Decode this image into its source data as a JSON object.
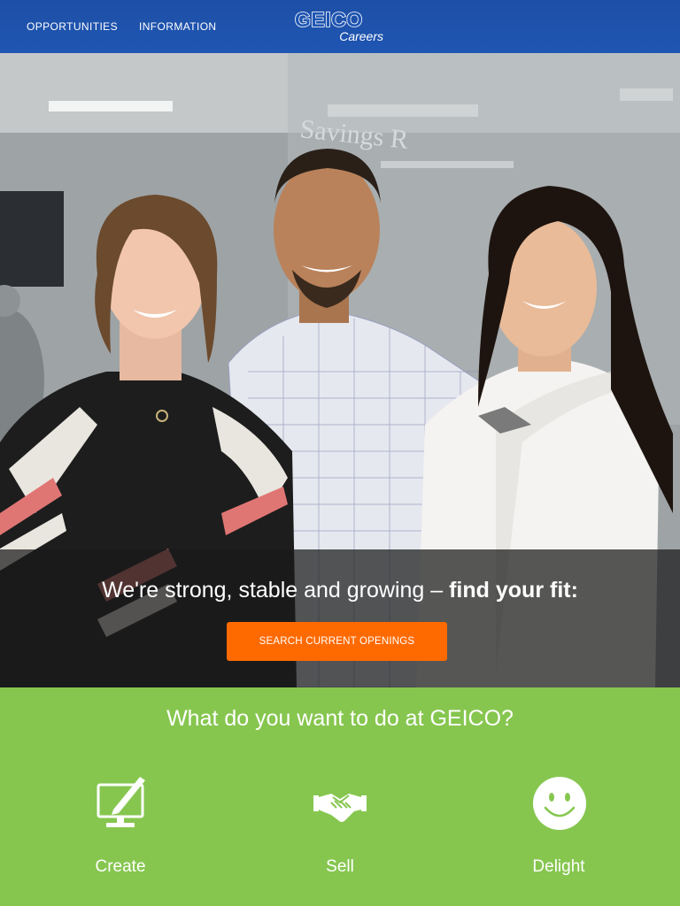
{
  "header": {
    "nav": [
      "OPPORTUNITIES",
      "INFORMATION"
    ],
    "logo_main": "GEICO",
    "logo_sub": "Careers"
  },
  "hero": {
    "tagline_lead": "We're strong, stable and growing – ",
    "tagline_emphasis": "find your fit:",
    "cta_label": "SEARCH CURRENT OPENINGS",
    "background_text": "Savings R"
  },
  "paths": {
    "question": "What do you want to do at GEICO?",
    "items": [
      {
        "label": "Create",
        "icon": "monitor-pen-icon"
      },
      {
        "label": "Sell",
        "icon": "handshake-icon"
      },
      {
        "label": "Delight",
        "icon": "smiley-icon"
      }
    ]
  },
  "colors": {
    "header_blue": "#1f56b3",
    "cta_orange": "#ff6a00",
    "section_green": "#86c64f"
  }
}
